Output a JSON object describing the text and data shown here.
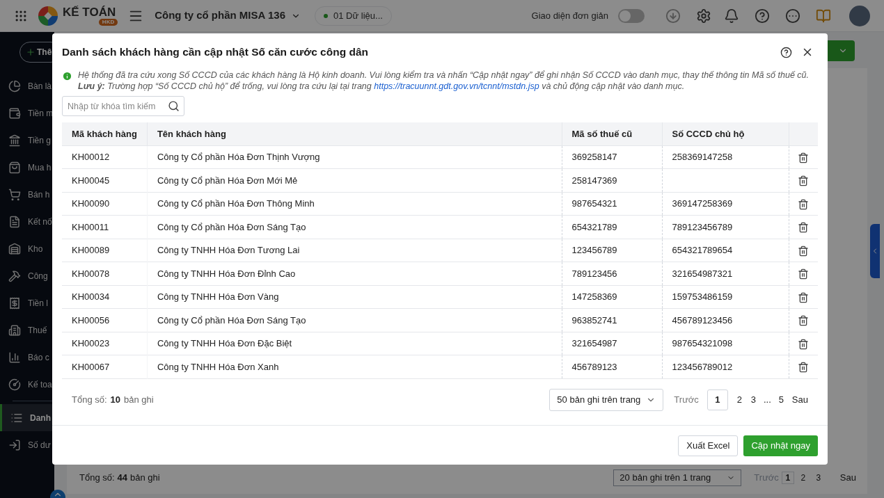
{
  "top_bar": {
    "product_name": "KẾ TOÁN",
    "product_badge": "HKD",
    "company": "Công ty cổ phần MISA 136",
    "data_set": "01 Dữ liệu...",
    "simple_mode": {
      "label": "Giao diện đơn giản",
      "on": false
    }
  },
  "sidebar": {
    "new_button": "Thê",
    "items": [
      {
        "label": "Bàn là",
        "selected": false
      },
      {
        "label": "Tiền m",
        "selected": false
      },
      {
        "label": "Tiền g",
        "selected": false
      },
      {
        "label": "Mua h",
        "selected": false
      },
      {
        "label": "Bán h",
        "selected": false
      },
      {
        "label": "Kết nố",
        "selected": false
      },
      {
        "label": "Kho",
        "selected": false
      },
      {
        "label": "Công",
        "selected": false
      },
      {
        "label": "Tiền l",
        "selected": false
      },
      {
        "label": "Thuế",
        "selected": false
      },
      {
        "label": "Báo c",
        "selected": false
      },
      {
        "label": "Kế toa",
        "selected": false
      },
      {
        "label": "Danh",
        "selected": true
      },
      {
        "label": "Số dư",
        "selected": false
      }
    ]
  },
  "page_behind": {
    "total_label": "Tổng số:",
    "total": "44",
    "total_unit": "bản ghi",
    "page_size": "20 bản ghi trên 1 trang",
    "prev": "Trước",
    "pages": [
      {
        "label": "1",
        "selected": true
      },
      {
        "label": "2",
        "selected": false
      },
      {
        "label": "3",
        "selected": false
      }
    ],
    "next": "Sau"
  },
  "dialog": {
    "title": "Danh sách khách hàng cần cập nhật Số căn cước công dân",
    "notice_before": "Hệ thống đã tra cứu xong Số CCCD của các khách hàng là Hộ kinh doanh. Vui lòng kiểm tra và nhấn “Cập nhật ngay” để ghi nhận Số CCCD vào danh mục, thay thế thông tin Mã số thuế cũ. **Lưu ý:** Trường hợp “Số CCCD chủ hộ” để trống, vui lòng tra cứu lại tại trang",
    "notice_link": "https://tracuunnt.gdt.gov.vn/tcnnt/mstdn.jsp",
    "notice_after": "và chủ động cập nhật vào danh mục.",
    "search": {
      "placeholder": "Nhập từ khóa tìm kiếm"
    },
    "table": {
      "columns": [
        "Mã khách hàng",
        "Tên khách hàng",
        "Mã số thuế cũ",
        "Số CCCD chủ hộ"
      ],
      "rows": [
        [
          "KH00012",
          "Công ty Cổ phần Hóa Đơn Thịnh Vượng",
          "369258147",
          "258369147258"
        ],
        [
          "KH00045",
          "Công ty Cổ phần Hóa Đơn Mới Mẻ",
          "258147369",
          ""
        ],
        [
          "KH00090",
          "Công ty Cổ phần Hóa Đơn Thông Minh",
          "987654321",
          "369147258369"
        ],
        [
          "KH00011",
          "Công ty Cổ phần Hóa Đơn Sáng Tạo",
          "654321789",
          "789123456789"
        ],
        [
          "KH00089",
          "Công ty TNHH Hóa Đơn Tương Lai",
          "123456789",
          "654321789654"
        ],
        [
          "KH00078",
          "Công ty TNHH Hóa Đơn Đỉnh Cao",
          "789123456",
          "321654987321"
        ],
        [
          "KH00034",
          "Công ty TNHH Hóa Đơn Vàng",
          "147258369",
          "159753486159"
        ],
        [
          "KH00056",
          "Công ty Cổ phần Hóa Đơn Sáng Tạo",
          "963852741",
          "456789123456"
        ],
        [
          "KH00023",
          "Công ty TNHH Hóa Đơn Đặc Biệt",
          "321654987",
          "987654321098"
        ],
        [
          "KH00067",
          "Công ty TNHH Hóa Đơn Xanh",
          "456789123",
          "123456789012"
        ]
      ]
    },
    "total_label": "Tổng số:",
    "total": "10",
    "total_unit": "bản ghi",
    "page_size": "50 bản ghi trên trang",
    "prev": "Trước",
    "pages": [
      {
        "label": "1",
        "selected": true
      },
      {
        "label": "2",
        "selected": false
      },
      {
        "label": "3",
        "selected": false
      },
      {
        "label": "...",
        "selected": false
      },
      {
        "label": "5",
        "selected": false
      }
    ],
    "next": "Sau",
    "buttons": [
      "Xuất Excel",
      "Cập nhật ngay"
    ]
  }
}
